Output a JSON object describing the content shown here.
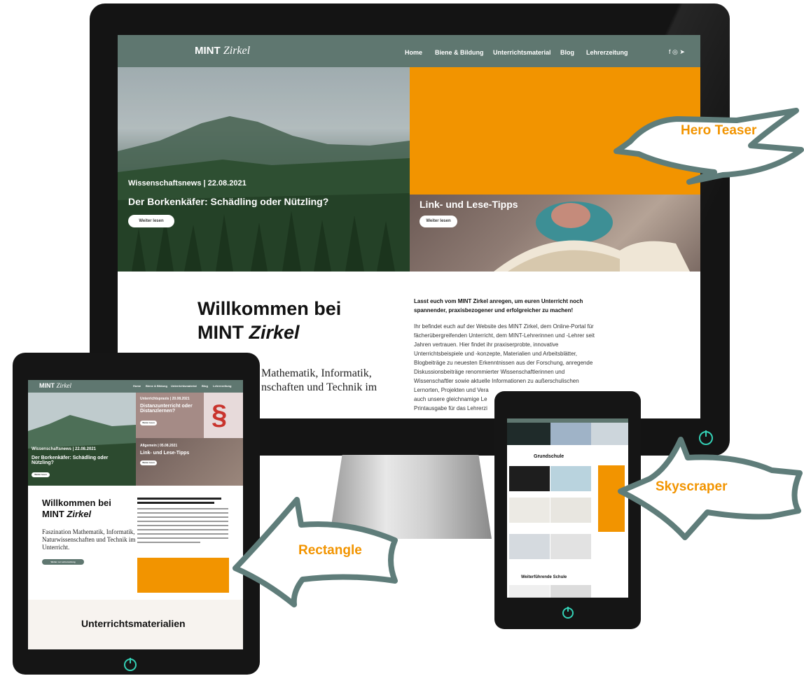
{
  "site": {
    "logo_main": "MINT",
    "logo_italic": "Zirkel",
    "nav": [
      "Home",
      "Biene & Bildung",
      "Unterrichtsmaterial",
      "Blog",
      "Lehrerzeitung"
    ],
    "social_icons": [
      "facebook-icon",
      "instagram-icon",
      "twitter-icon"
    ],
    "social_glyphs": "f  ◎  ➤"
  },
  "hero": {
    "left_kicker": "Wissenschaftsnews | 22.08.2021",
    "left_title": "Der Borkenkäfer: Schädling oder Nützling?",
    "left_button": "Weiter lesen",
    "right_title": "Link- und Lese-Tipps",
    "right_button": "Weiter lesen"
  },
  "welcome": {
    "line1": "Willkommen bei",
    "line2_plain": "MINT ",
    "line2_italic": "Zirkel",
    "sub_partial_1": "Mathematik, Informatik,",
    "sub_partial_2": "nschaften und Technik im",
    "lead": "Lasst euch vom MINT Zirkel anregen, um euren Unterricht noch spannender, praxisbezogener und erfolgreicher zu machen!",
    "body_lines": [
      "Ihr befindet euch auf der Website des MINT Zirkel,  dem Online-Portal für",
      "fächerübergreifenden Unterricht, dem MINT-Lehrerinnen und -Lehrer seit",
      "Jahren vertrauen. Hier findet ihr praxiserprobte, innovative",
      "Unterrichtsbeispiele und -konzepte, Materialien und Arbeitsblätter,",
      "Blogbeiträge zu neuesten Erkenntnissen aus der Forschung, anregende",
      "Diskussionsbeiträge renommierter Wissenschaftlerinnen und",
      "Wissenschaftler sowie aktuelle Informationen zu außerschulischen",
      "Lernorten, Projekten und Vera",
      "auch unsere gleichnamige Le",
      "Printausgabe für das Lehrerzi"
    ]
  },
  "tablet": {
    "logo_main": "MINT",
    "logo_italic": "Zirkel",
    "nav": [
      "Home",
      "Biene & Bildung",
      "Unterrichtsmaterial",
      "Blog",
      "Lehrerzeitung"
    ],
    "promo_kicker": "Unterrichtspraxis | 20.08.2021",
    "promo_title": "Distanzunterricht oder Distanzlernen?",
    "promo_button": "Weiter lesen",
    "promo2_kicker": "Allgemein | 05.08.2021",
    "promo2_title": "Link- und Lese-Tipps",
    "promo2_button": "Weiter lesen",
    "left_kicker": "Wissenschaftsnews | 22.08.2021",
    "left_title": "Der Borkenkäfer: Schädling oder Nützling?",
    "left_button": "Weiter lesen",
    "welcome_line1": "Willkommen bei",
    "welcome_line2_plain": "MINT ",
    "welcome_line2_italic": "Zirkel",
    "welcome_sub": "Faszination Mathematik, Informatik, Naturwissenschaften und Technik im Unterricht.",
    "welcome_button": "Weiter zur Lehrerzeitung",
    "section_title": "Unterrichtsmaterialien"
  },
  "phone": {
    "section_1": "Grundschule",
    "section_2": "Weiterführende Schule"
  },
  "callouts": {
    "hero": "Hero Teaser",
    "rectangle": "Rectangle",
    "skyscraper": "Skyscraper"
  },
  "colors": {
    "accent": "#f29400",
    "nav_bg": "#5f7770",
    "callout_arrow": "#5f7d7a",
    "power": "#34d1b6"
  }
}
